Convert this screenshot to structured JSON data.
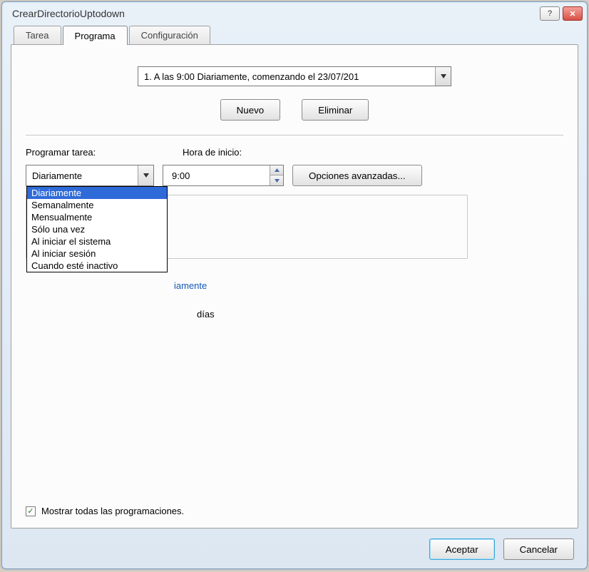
{
  "titlebar": {
    "title": "CrearDirectorioUptodown"
  },
  "tabs": [
    "Tarea",
    "Programa",
    "Configuración"
  ],
  "active_tab": 1,
  "schedule_dropdown": "1. A las 9:00 Diariamente, comenzando el 23/07/201",
  "buttons": {
    "new": "Nuevo",
    "delete": "Eliminar",
    "advanced": "Opciones avanzadas...",
    "ok": "Aceptar",
    "cancel": "Cancelar"
  },
  "labels": {
    "schedule_task": "Programar tarea:",
    "start_time": "Hora de inicio:"
  },
  "frequency_selected": "Diariamente",
  "frequency_options": [
    "Diariamente",
    "Semanalmente",
    "Mensualmente",
    "Sólo una vez",
    "Al iniciar el sistema",
    "Al iniciar sesión",
    "Cuando esté inactivo"
  ],
  "start_time": "9:00",
  "group_title_partial": "iamente",
  "days_label": "días",
  "show_all_checkbox": {
    "checked": true,
    "label": "Mostrar todas las programaciones."
  }
}
